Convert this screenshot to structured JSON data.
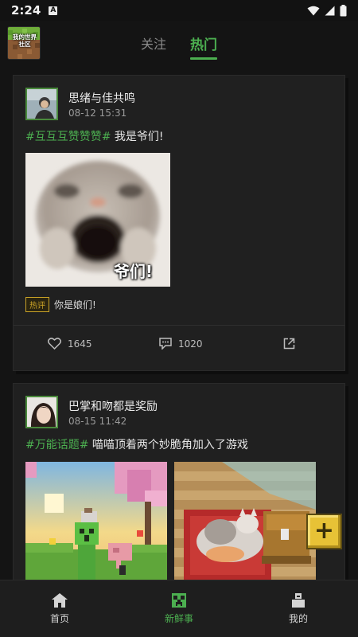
{
  "status_bar": {
    "time": "2:24",
    "notification_glyph": "A"
  },
  "header": {
    "logo_text_line1": "我的世界",
    "logo_text_line2": "社区",
    "tabs": [
      {
        "label": "关注",
        "active": false
      },
      {
        "label": "热门",
        "active": true
      }
    ]
  },
  "posts": [
    {
      "username": "思绪与佳共鸣",
      "timestamp": "08-12 15:31",
      "topic": "#互互互赞赞赞#",
      "text": " 我是爷们!",
      "image_caption": "爷们!",
      "hot_badge": "热评",
      "hot_comment": "你是娘们!",
      "likes": "1645",
      "comments": "1020"
    },
    {
      "username": "巴掌和吻都是奖励",
      "timestamp": "08-15 11:42",
      "topic": "#万能话题#",
      "text": " 喵喵顶着两个妙脆角加入了游戏"
    }
  ],
  "bottom_nav": [
    {
      "label": "首页",
      "icon": "home-icon",
      "active": false
    },
    {
      "label": "新鲜事",
      "icon": "creeper-icon",
      "active": true
    },
    {
      "label": "我的",
      "icon": "profile-icon",
      "active": false
    }
  ],
  "colors": {
    "accent": "#4caf50",
    "hot_badge": "#c9a227",
    "fab": "#e7c236"
  }
}
